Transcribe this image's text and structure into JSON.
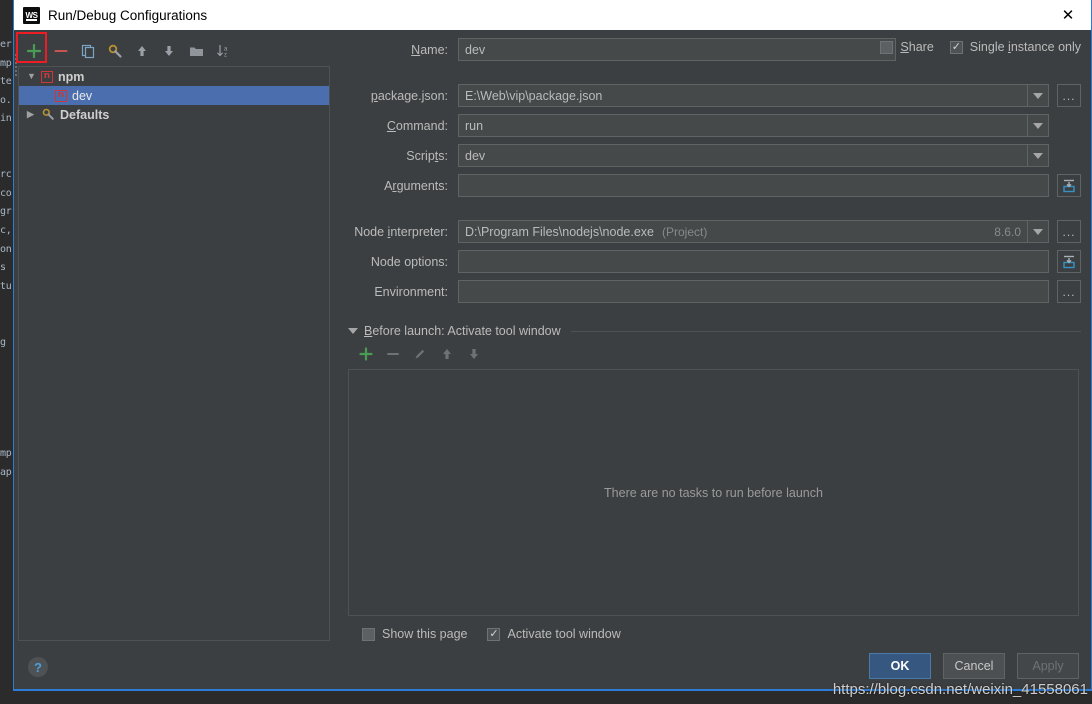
{
  "window": {
    "title": "Run/Debug Configurations",
    "app_icon": "webstorm-logo-icon",
    "close_label": "✕"
  },
  "tree_toolbar": {
    "buttons": [
      {
        "name": "add-configuration-button",
        "icon": "plus-icon",
        "label": "+"
      },
      {
        "name": "remove-configuration-button",
        "icon": "minus-icon",
        "label": "−"
      },
      {
        "name": "copy-configuration-button",
        "icon": "copy-icon",
        "label": ""
      },
      {
        "name": "edit-templates-button",
        "icon": "wrench-icon",
        "label": ""
      },
      {
        "name": "move-up-button",
        "icon": "arrow-up-icon",
        "label": ""
      },
      {
        "name": "move-down-button",
        "icon": "arrow-down-icon",
        "label": ""
      },
      {
        "name": "create-folder-button",
        "icon": "folder-icon",
        "label": ""
      },
      {
        "name": "sort-configurations-button",
        "icon": "sort-alpha-icon",
        "label": ""
      }
    ],
    "highlight_color": "#ee1c25"
  },
  "tree": {
    "nodes": [
      {
        "label": "npm",
        "icon": "npm-icon",
        "expanded": true,
        "selected": false,
        "level": 0
      },
      {
        "label": "dev",
        "icon": "npm-icon",
        "expanded": false,
        "selected": true,
        "level": 1
      },
      {
        "label": "Defaults",
        "icon": "wrench-icon",
        "expanded": false,
        "selected": false,
        "level": 0
      }
    ],
    "selection_color": "#4b6eaf"
  },
  "form": {
    "name": {
      "label": "Name:",
      "mnemonic": "N",
      "value": "dev"
    },
    "package_json": {
      "label": "package.json:",
      "mnemonic": "p",
      "value": "E:\\Web\\vip\\package.json",
      "browse": "..."
    },
    "command": {
      "label": "Command:",
      "mnemonic": "C",
      "value": "run"
    },
    "scripts": {
      "label": "Scripts:",
      "mnemonic": "t",
      "value": "dev"
    },
    "arguments": {
      "label": "Arguments:",
      "mnemonic": "r",
      "value": "",
      "expand_icon": "expand-editor-icon"
    },
    "node_interpreter": {
      "label": "Node interpreter:",
      "mnemonic": "i",
      "value": "D:\\Program Files\\nodejs\\node.exe",
      "suffix": "(Project)",
      "version": "8.6.0",
      "browse": "..."
    },
    "node_options": {
      "label": "Node options:",
      "value": "",
      "expand_icon": "expand-editor-icon"
    },
    "environment": {
      "label": "Environment:",
      "value": "",
      "browse": "..."
    }
  },
  "top_options": [
    {
      "name": "share-checkbox",
      "label": "Share",
      "mnemonic": "S",
      "checked": false
    },
    {
      "name": "single-instance-checkbox",
      "label": "Single instance only",
      "mnemonic": "i",
      "checked": true
    }
  ],
  "before_launch": {
    "title": "Before launch: Activate tool window",
    "mnemonic": "B",
    "expanded": true,
    "toolbar": [
      {
        "name": "add-task-button",
        "icon": "plus-icon",
        "enabled": true
      },
      {
        "name": "remove-task-button",
        "icon": "minus-icon",
        "enabled": false
      },
      {
        "name": "edit-task-button",
        "icon": "pencil-icon",
        "enabled": false
      },
      {
        "name": "move-task-up-button",
        "icon": "arrow-up-icon",
        "enabled": false
      },
      {
        "name": "move-task-down-button",
        "icon": "arrow-down-icon",
        "enabled": false
      }
    ],
    "empty_text": "There are no tasks to run before launch",
    "options": [
      {
        "name": "show-this-page-checkbox",
        "label": "Show this page",
        "checked": false
      },
      {
        "name": "activate-tool-window-checkbox",
        "label": "Activate tool window",
        "checked": true
      }
    ]
  },
  "footer": {
    "help": "?",
    "buttons": [
      {
        "name": "ok-button",
        "label": "OK",
        "style": "primary",
        "enabled": true
      },
      {
        "name": "cancel-button",
        "label": "Cancel",
        "style": "normal",
        "enabled": true
      },
      {
        "name": "apply-button",
        "label": "Apply",
        "style": "disabled",
        "enabled": false
      }
    ]
  },
  "watermark": "https://blog.csdn.net/weixin_41558061",
  "backdrop": {
    "code_fragment": "er\nmp\nte\no.\nin\n\n\nrc\nco\ngr\nc,\non\ns\ntu\n\n\ng\n\n\n\n\n\nmp\nap"
  }
}
